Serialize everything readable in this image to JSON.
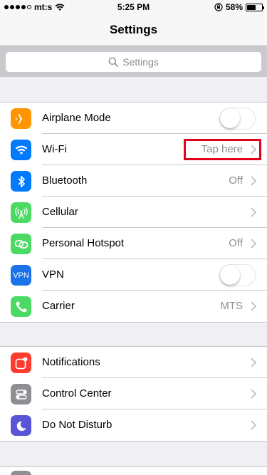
{
  "status_bar": {
    "carrier": "mt:s",
    "time": "5:25 PM",
    "battery_percent": "58%",
    "battery_level": 0.58,
    "signal_dots_filled": 4,
    "signal_dots_total": 5
  },
  "nav": {
    "title": "Settings"
  },
  "search": {
    "placeholder": "Settings"
  },
  "group1": [
    {
      "label": "Airplane Mode",
      "icon": "airplane-icon",
      "color": "#ff9500",
      "accessory": "toggle",
      "on": false
    },
    {
      "label": "Wi-Fi",
      "icon": "wifi-icon",
      "color": "#007aff",
      "accessory": "chevron",
      "detail": "Tap here",
      "highlighted": true
    },
    {
      "label": "Bluetooth",
      "icon": "bluetooth-icon",
      "color": "#007aff",
      "accessory": "chevron",
      "detail": "Off"
    },
    {
      "label": "Cellular",
      "icon": "cellular-icon",
      "color": "#4cd964",
      "accessory": "chevron",
      "detail": ""
    },
    {
      "label": "Personal Hotspot",
      "icon": "hotspot-icon",
      "color": "#4cd964",
      "accessory": "chevron",
      "detail": "Off"
    },
    {
      "label": "VPN",
      "icon": "vpn-icon",
      "icon_text": "VPN",
      "color": "#1a73e8",
      "accessory": "toggle",
      "on": false
    },
    {
      "label": "Carrier",
      "icon": "phone-icon",
      "color": "#4cd964",
      "accessory": "chevron",
      "detail": "MTS"
    }
  ],
  "group2": [
    {
      "label": "Notifications",
      "icon": "notifications-icon",
      "color": "#ff3b30",
      "accessory": "chevron"
    },
    {
      "label": "Control Center",
      "icon": "control-center-icon",
      "color": "#8e8e93",
      "accessory": "chevron"
    },
    {
      "label": "Do Not Disturb",
      "icon": "moon-icon",
      "color": "#5856d6",
      "accessory": "chevron"
    }
  ]
}
